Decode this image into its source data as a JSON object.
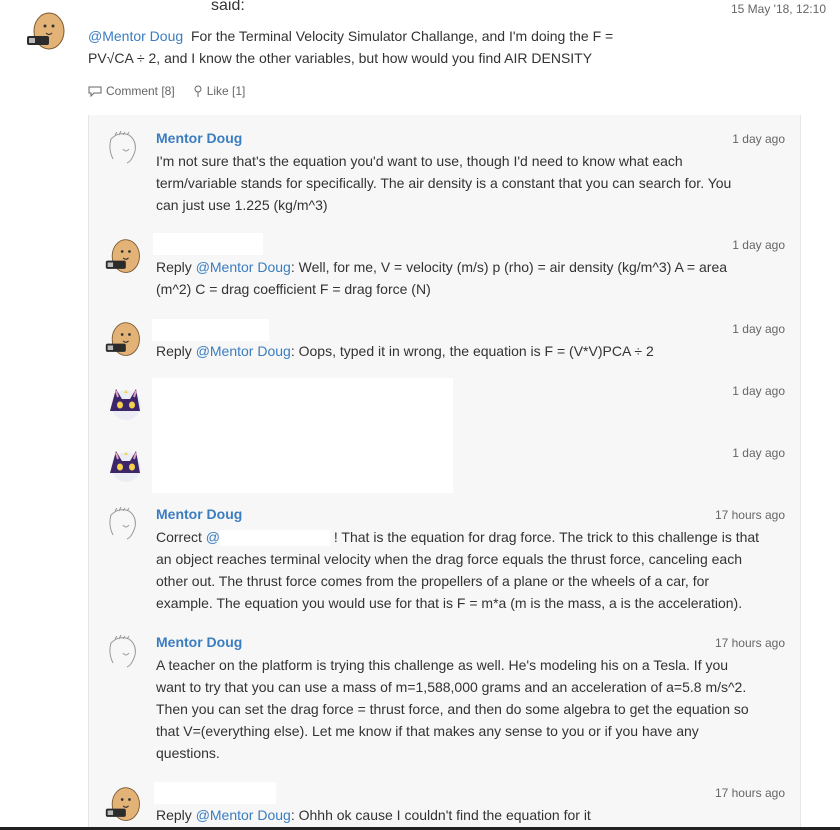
{
  "post": {
    "said_label": "said:",
    "timestamp": "15 May '18, 12:10",
    "mention": "@Mentor Doug",
    "text_line1": "For the Terminal Velocity Simulator Challange, and I'm doing the F =",
    "text_line2": "PV√CA ÷ 2, and I know the other variables, but how would you find AIR DENSITY",
    "comment_label": "Comment [8]",
    "like_label": "Like [1]"
  },
  "comments": [
    {
      "author": "Mentor Doug",
      "time": "1 day ago",
      "lines": [
        "I'm not sure that's the equation you'd want to use, though I'd need to know what each",
        "term/variable stands for specifically. The air density is a constant that you can search for. You",
        "can just use 1.225 (kg/m^3)"
      ]
    },
    {
      "author": "",
      "time": "1 day ago",
      "reply_prefix": "Reply",
      "mention": "@Mentor Doug",
      "line1": ": Well, for me, V = velocity (m/s) p (rho) = air density (kg/m^3) A = area",
      "line2": "(m^2) C = drag coefficient F = drag force (N)"
    },
    {
      "author": "",
      "time": "1 day ago",
      "reply_prefix": "Reply",
      "mention": "@Mentor Doug",
      "line1": ": Oops, typed it in wrong, the equation is F = (V*V)PCA ÷ 2"
    },
    {
      "author": "",
      "time": "1 day ago"
    },
    {
      "author": "",
      "time": "1 day ago"
    },
    {
      "author": "Mentor Doug",
      "time": "17 hours ago",
      "prefix": "Correct",
      "mention": "@",
      "line1_rest": "! That is the equation for drag force. The trick to this challenge is that",
      "lines": [
        "an object reaches terminal velocity when the drag force equals the thrust force, canceling each",
        "other out. The thrust force comes from the propellers of a plane or the wheels of a car, for",
        "example. The equation you would use for that is F = m*a (m is the mass, a is the acceleration)."
      ]
    },
    {
      "author": "Mentor Doug",
      "time": "17 hours ago",
      "lines": [
        "A teacher on the platform is trying this challenge as well. He's modeling his on a Tesla. If you",
        "want to try that you can use a mass of m=1,588,000 grams and an acceleration of a=5.8 m/s^2.",
        "Then you can set the drag force = thrust force, and then do some algebra to get the equation so",
        "that V=(everything else). Let me know if that makes any sense to you or if you have any",
        "questions."
      ]
    },
    {
      "author": "",
      "time": "17 hours ago",
      "reply_prefix": "Reply",
      "mention": "@Mentor Doug",
      "line1": ": Ohhh ok cause I couldn't find the equation for it"
    }
  ]
}
